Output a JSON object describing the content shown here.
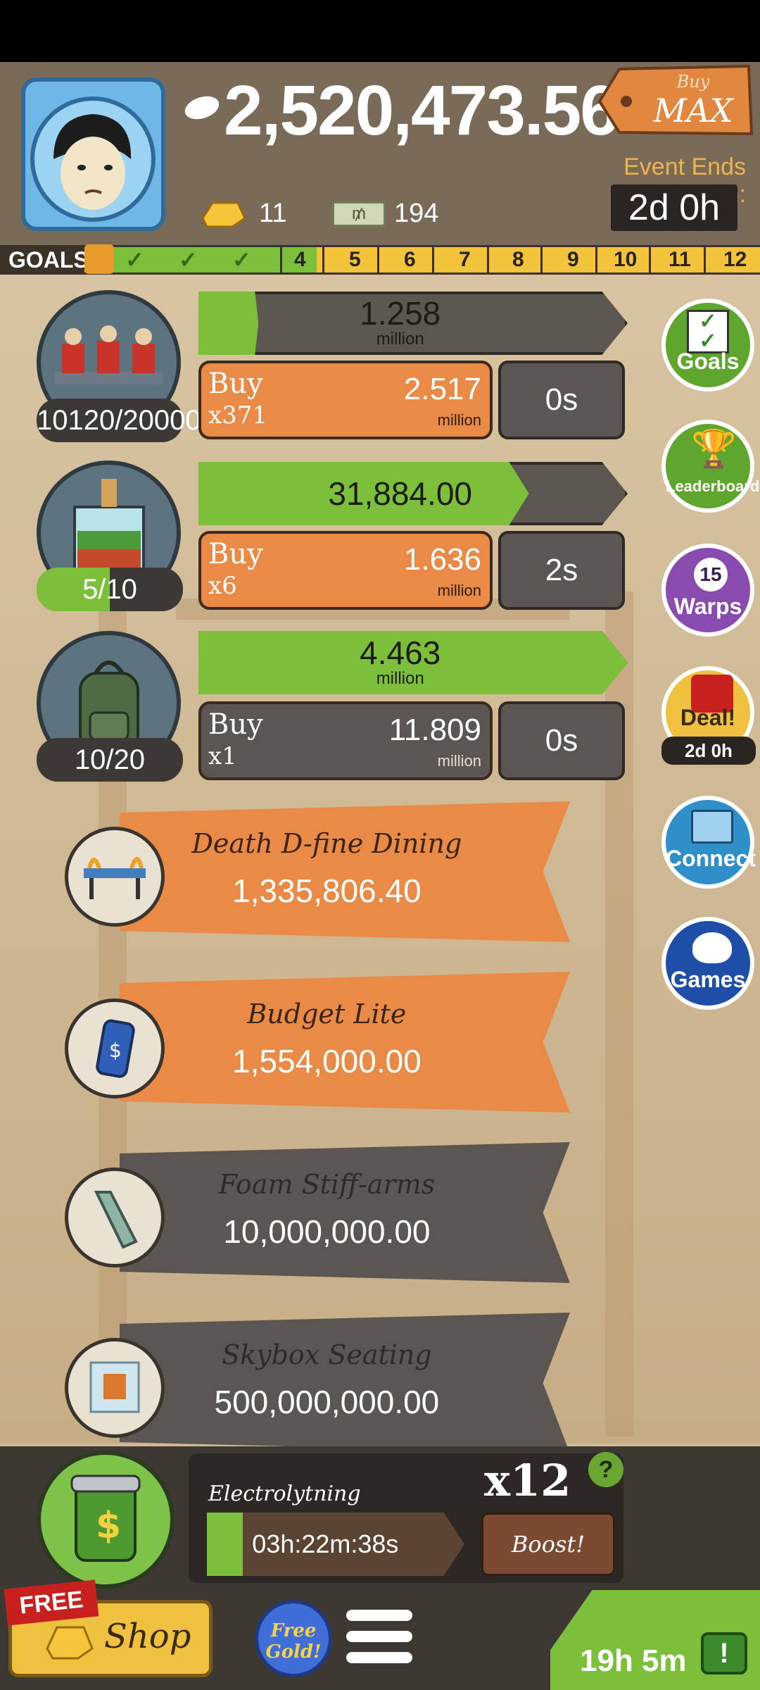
{
  "header": {
    "cash": "2,520,473.56",
    "gold": "11",
    "bills": "194",
    "buymax_top": "Buy",
    "buymax_bottom": "MAX",
    "event_label": "Event Ends in:",
    "event_time": "2d 0h"
  },
  "goals": {
    "label": "GOALS",
    "numbers": [
      "4",
      "5",
      "6",
      "7",
      "8",
      "9",
      "10",
      "11",
      "12"
    ],
    "completed": 3
  },
  "businesses": [
    {
      "progress_value": "1.258",
      "progress_unit": "million",
      "progress_fraction": 0.14,
      "buy_word": "Buy",
      "buy_qty": "x371",
      "cost": "2.517",
      "cost_unit": "million",
      "timer": "0s",
      "count": "10120/20000",
      "count_fraction": 0.506
    },
    {
      "progress_value": "31,884.00",
      "progress_unit": "",
      "progress_fraction": 0.77,
      "buy_word": "Buy",
      "buy_qty": "x6",
      "cost": "1.636",
      "cost_unit": "million",
      "timer": "2s",
      "count": "5/10",
      "count_fraction": 0.5
    },
    {
      "progress_value": "4.463",
      "progress_unit": "million",
      "progress_fraction": 1.0,
      "buy_word": "Buy",
      "buy_qty": "x1",
      "cost": "11.809",
      "cost_unit": "million",
      "timer": "0s",
      "count": "10/20",
      "count_fraction": 0.5
    }
  ],
  "unlocks": [
    {
      "name": "Death D-fine Dining",
      "price": "1,335,806.40",
      "style": "orange"
    },
    {
      "name": "Budget Lite",
      "price": "1,554,000.00",
      "style": "orange"
    },
    {
      "name": "Foam Stiff-arms",
      "price": "10,000,000.00",
      "style": "grey"
    },
    {
      "name": "Skybox Seating",
      "price": "500,000,000.00",
      "style": "grey"
    }
  ],
  "sidebar": {
    "goals": "Goals",
    "leaderboard": "Leaderboard",
    "warps_count": "15",
    "warps": "Warps",
    "deal": "Deal!",
    "deal_time": "2d 0h",
    "connect": "Connect",
    "games": "Games"
  },
  "boost": {
    "title": "Electrolytning",
    "multiplier": "x12",
    "help": "?",
    "timer": "03h:22m:38s",
    "button": "Boost!"
  },
  "bottom": {
    "free_tag": "FREE",
    "shop": "Shop",
    "free_gold_1": "Free",
    "free_gold_2": "Gold!",
    "tv_time": "19h 5m",
    "tv_icon": "!"
  },
  "colors": {
    "accent_orange": "#e98a47",
    "progress_green": "#7cbf3a",
    "goals_yellow": "#f3c33c",
    "header_brown": "#7a6b58"
  }
}
